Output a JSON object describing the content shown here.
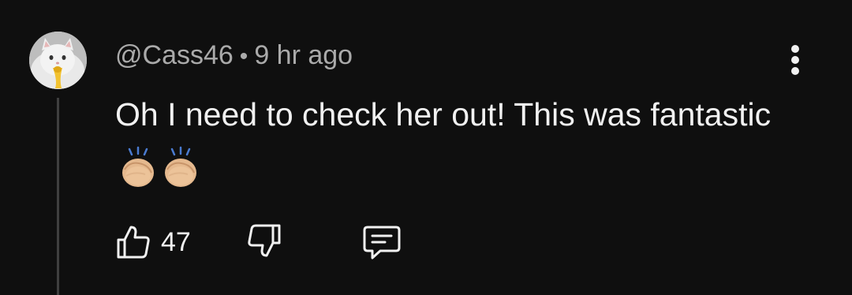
{
  "comment": {
    "author": "@Cass46",
    "separator": "•",
    "time": "9 hr ago",
    "text": "Oh I need to check her out! This was fantastic",
    "emoji": [
      "clapping-hands-emoji",
      "clapping-hands-emoji"
    ],
    "likes": "47",
    "avatar_icon": "cat-avatar-icon"
  },
  "icons": {
    "like": "thumbs-up-icon",
    "dislike": "thumbs-down-icon",
    "reply": "comment-reply-icon",
    "more": "more-vertical-icon"
  },
  "colors": {
    "background": "#0f0f0f",
    "text_primary": "#f1f1f1",
    "text_secondary": "#aaaaaa"
  }
}
